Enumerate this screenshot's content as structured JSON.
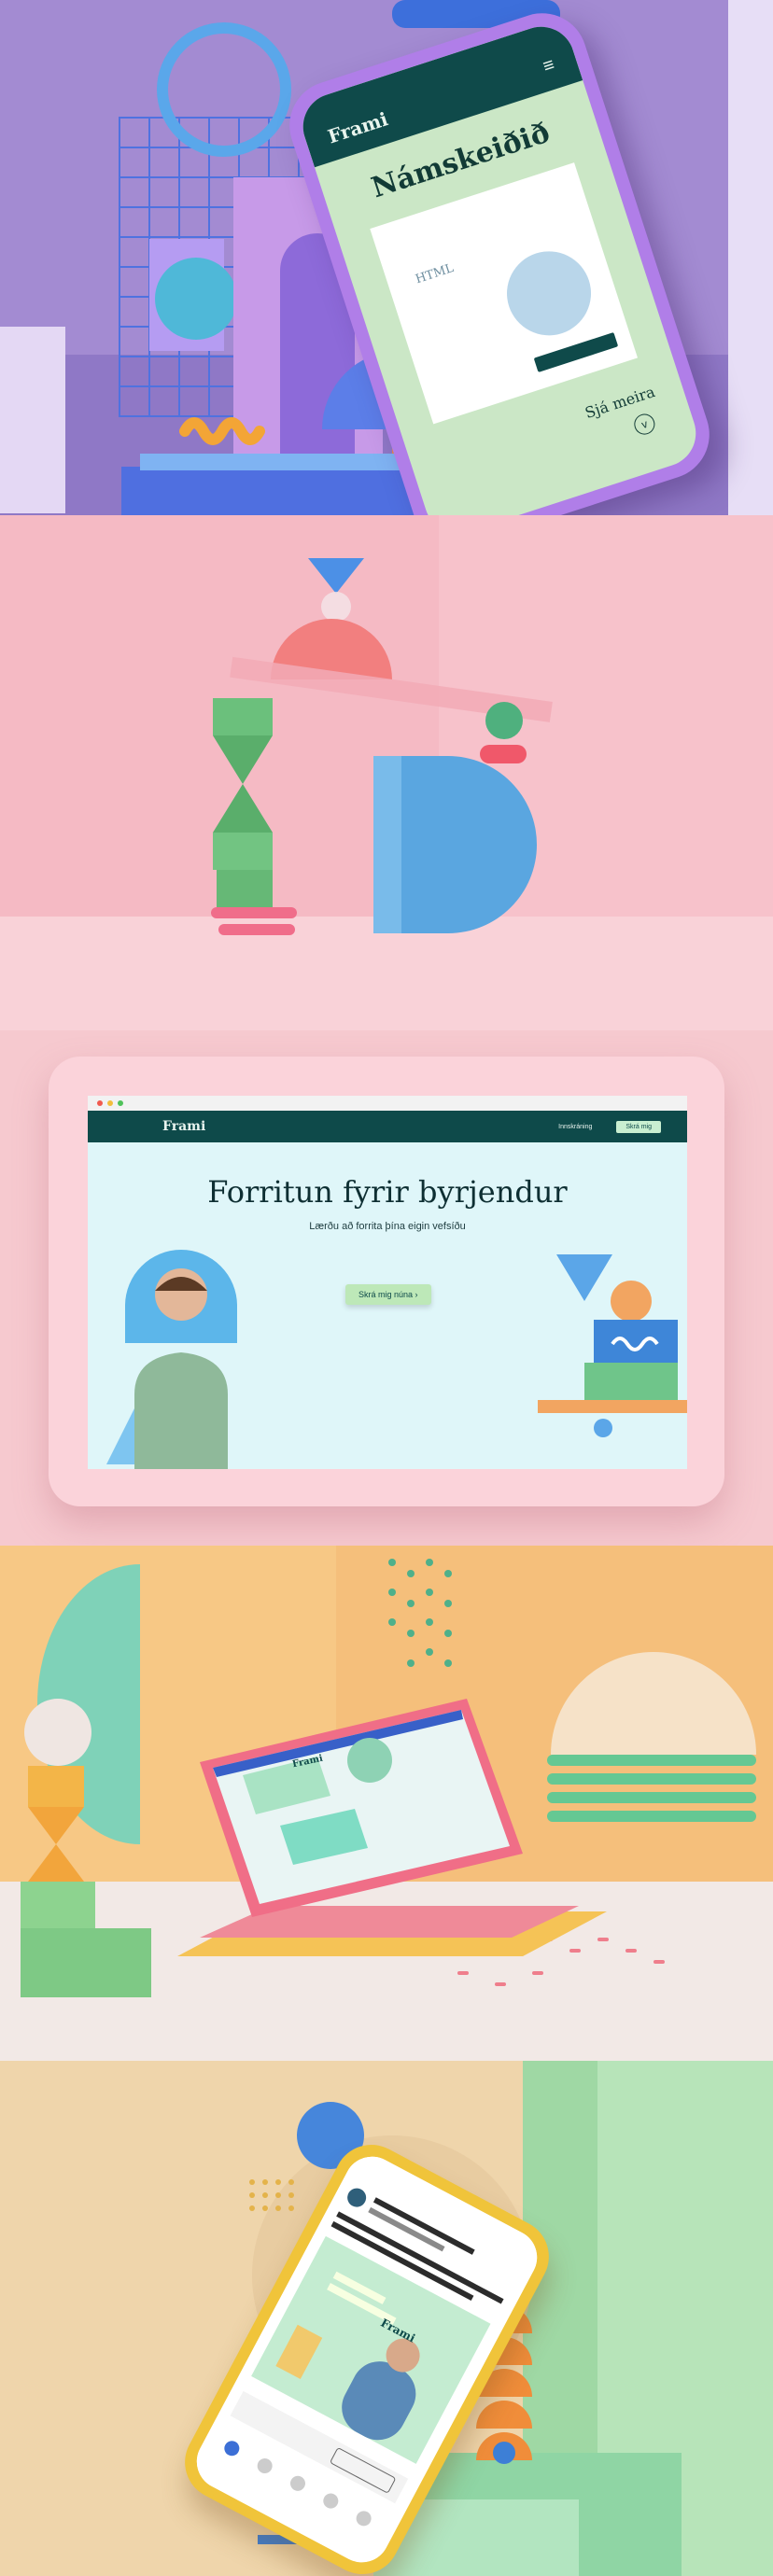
{
  "panel1": {
    "logo": "Frami",
    "heading": "Námskeiðið",
    "card_label": "HTML",
    "more_link": "Sjá meira",
    "menu_icon": "hamburger-icon",
    "chevron_icon": "chevron-down-icon"
  },
  "panel3": {
    "brand": "Frami",
    "nav_link": "Innskráning",
    "nav_button": "Skrá mig",
    "title": "Forritun fyrir byrjendur",
    "subtitle": "Lærðu að forrita þína eigin vefsíðu",
    "cta": "Skrá mig núna"
  },
  "panel4": {
    "brand": "Frami"
  },
  "panel5": {
    "brand": "Frami"
  },
  "colors": {
    "brand_dark": "#0e4a4a",
    "mint": "#c9efd1",
    "hero_bg": "#dff6f9",
    "pink": "#f6c9cf"
  }
}
